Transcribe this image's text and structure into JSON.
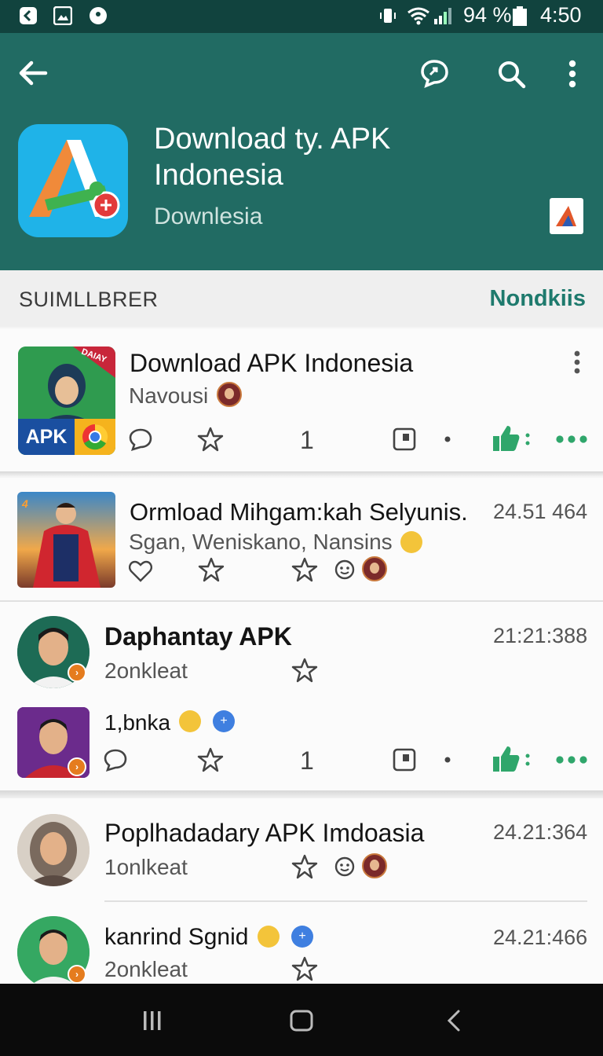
{
  "status_bar": {
    "battery_text": "94 %",
    "time": "4:50"
  },
  "header": {
    "title": "Download ty. APK Indonesia",
    "subtitle": "Downlesia",
    "icons": [
      "back-arrow-icon",
      "chat-icon",
      "search-icon",
      "more-vert-icon"
    ]
  },
  "section": {
    "title": "SUIMLLBRER",
    "action": "Nondkiis"
  },
  "items": [
    {
      "title": "Download APK Indonesia",
      "subtitle": "Navousi",
      "thumb_badge": "APK",
      "thumb_corner": "DAIAY",
      "count": "1"
    },
    {
      "title": "Ormload Mihgam:kah Selyunis.",
      "subtitle": "Sgan, Weniskano, Nansins",
      "meta": "24.51  464"
    },
    {
      "title": "Daphantay APK",
      "subtitle": "2onkleat",
      "meta": "21:21:388",
      "sub_title": "1,bnka",
      "count": "1"
    },
    {
      "title": "Poplhadadary APK Imdoasia",
      "subtitle": "1onlkeat",
      "meta": "24.21:364"
    },
    {
      "title": "kanrind Sgnid",
      "subtitle": "2onkleat",
      "meta": "24.21:466"
    }
  ],
  "colors": {
    "header": "#216b63",
    "status": "#11433e",
    "accent": "#1e7a6d",
    "like": "#2fa66b"
  }
}
